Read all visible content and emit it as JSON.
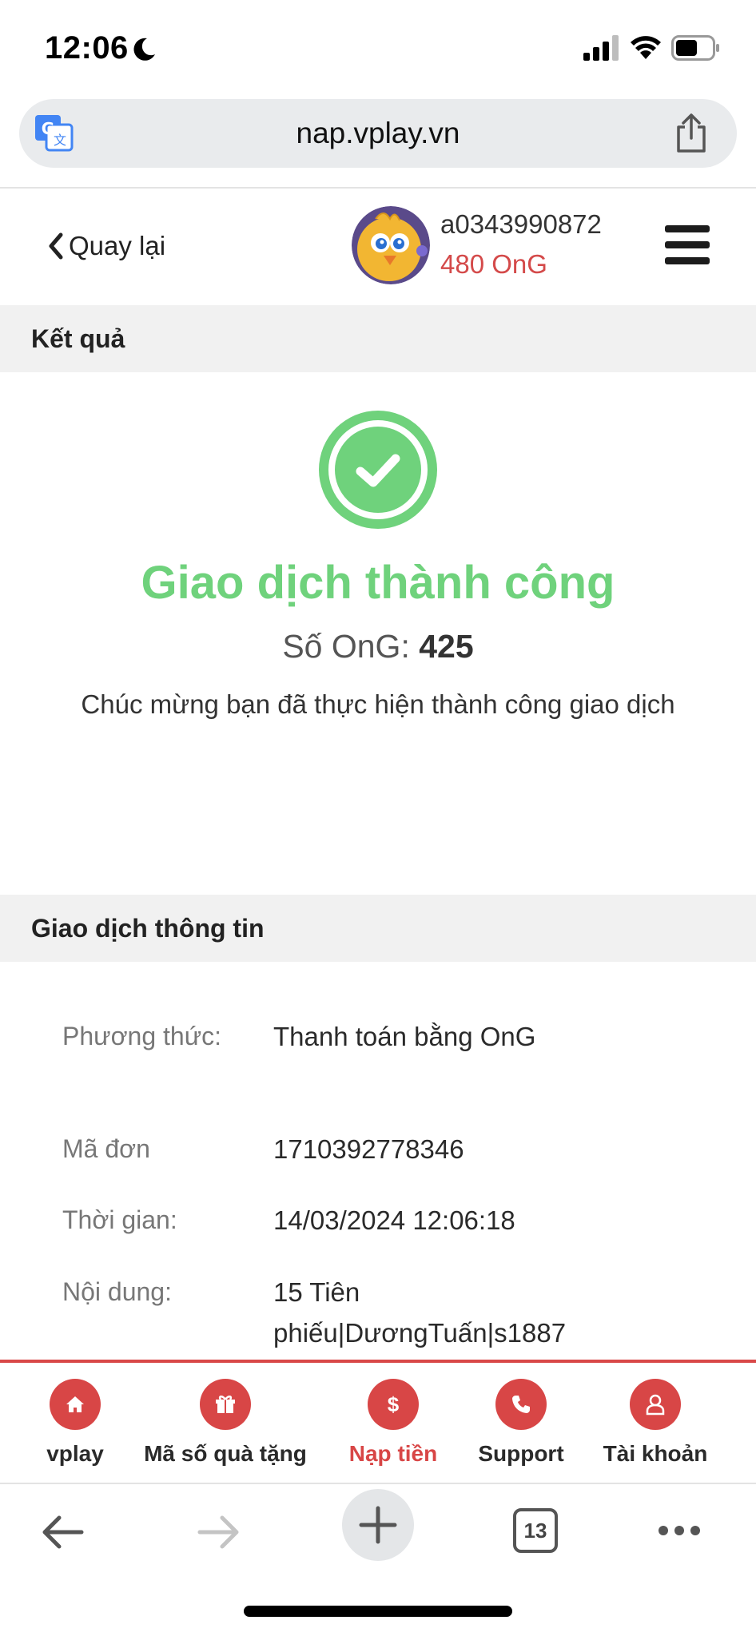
{
  "status_bar": {
    "time": "12:06"
  },
  "browser": {
    "url": "nap.vplay.vn",
    "tab_count": "13"
  },
  "header": {
    "back_label": "Quay lại",
    "username": "a0343990872",
    "balance": "480 OnG"
  },
  "result_section": {
    "heading": "Kết quả",
    "status_title": "Giao dịch thành công",
    "ong_label": "Số OnG:",
    "ong_value": "425",
    "message": "Chúc mừng bạn đã thực hiện thành công giao dịch"
  },
  "info_section": {
    "heading": "Giao dịch thông tin",
    "rows": [
      {
        "label": "Phương thức:",
        "value": "Thanh toán bằng OnG"
      },
      {
        "label": "Mã đơn",
        "value": "1710392778346"
      },
      {
        "label": "Thời gian:",
        "value": "14/03/2024 12:06:18"
      },
      {
        "label": "Nội dung:",
        "value": "15 Tiên phiếu|DươngTuấn|s1887"
      }
    ]
  },
  "bottom_nav": [
    {
      "label": "vplay",
      "icon": "home-icon",
      "active": false
    },
    {
      "label": "Mã số quà tặng",
      "icon": "gift-icon",
      "active": false
    },
    {
      "label": "Nạp tiền",
      "icon": "dollar-icon",
      "active": true
    },
    {
      "label": "Support",
      "icon": "phone-icon",
      "active": false
    },
    {
      "label": "Tài khoản",
      "icon": "user-icon",
      "active": false
    }
  ],
  "colors": {
    "accent_red": "#d84646",
    "success_green": "#6fd27c",
    "balance_red": "#d44a4a"
  }
}
